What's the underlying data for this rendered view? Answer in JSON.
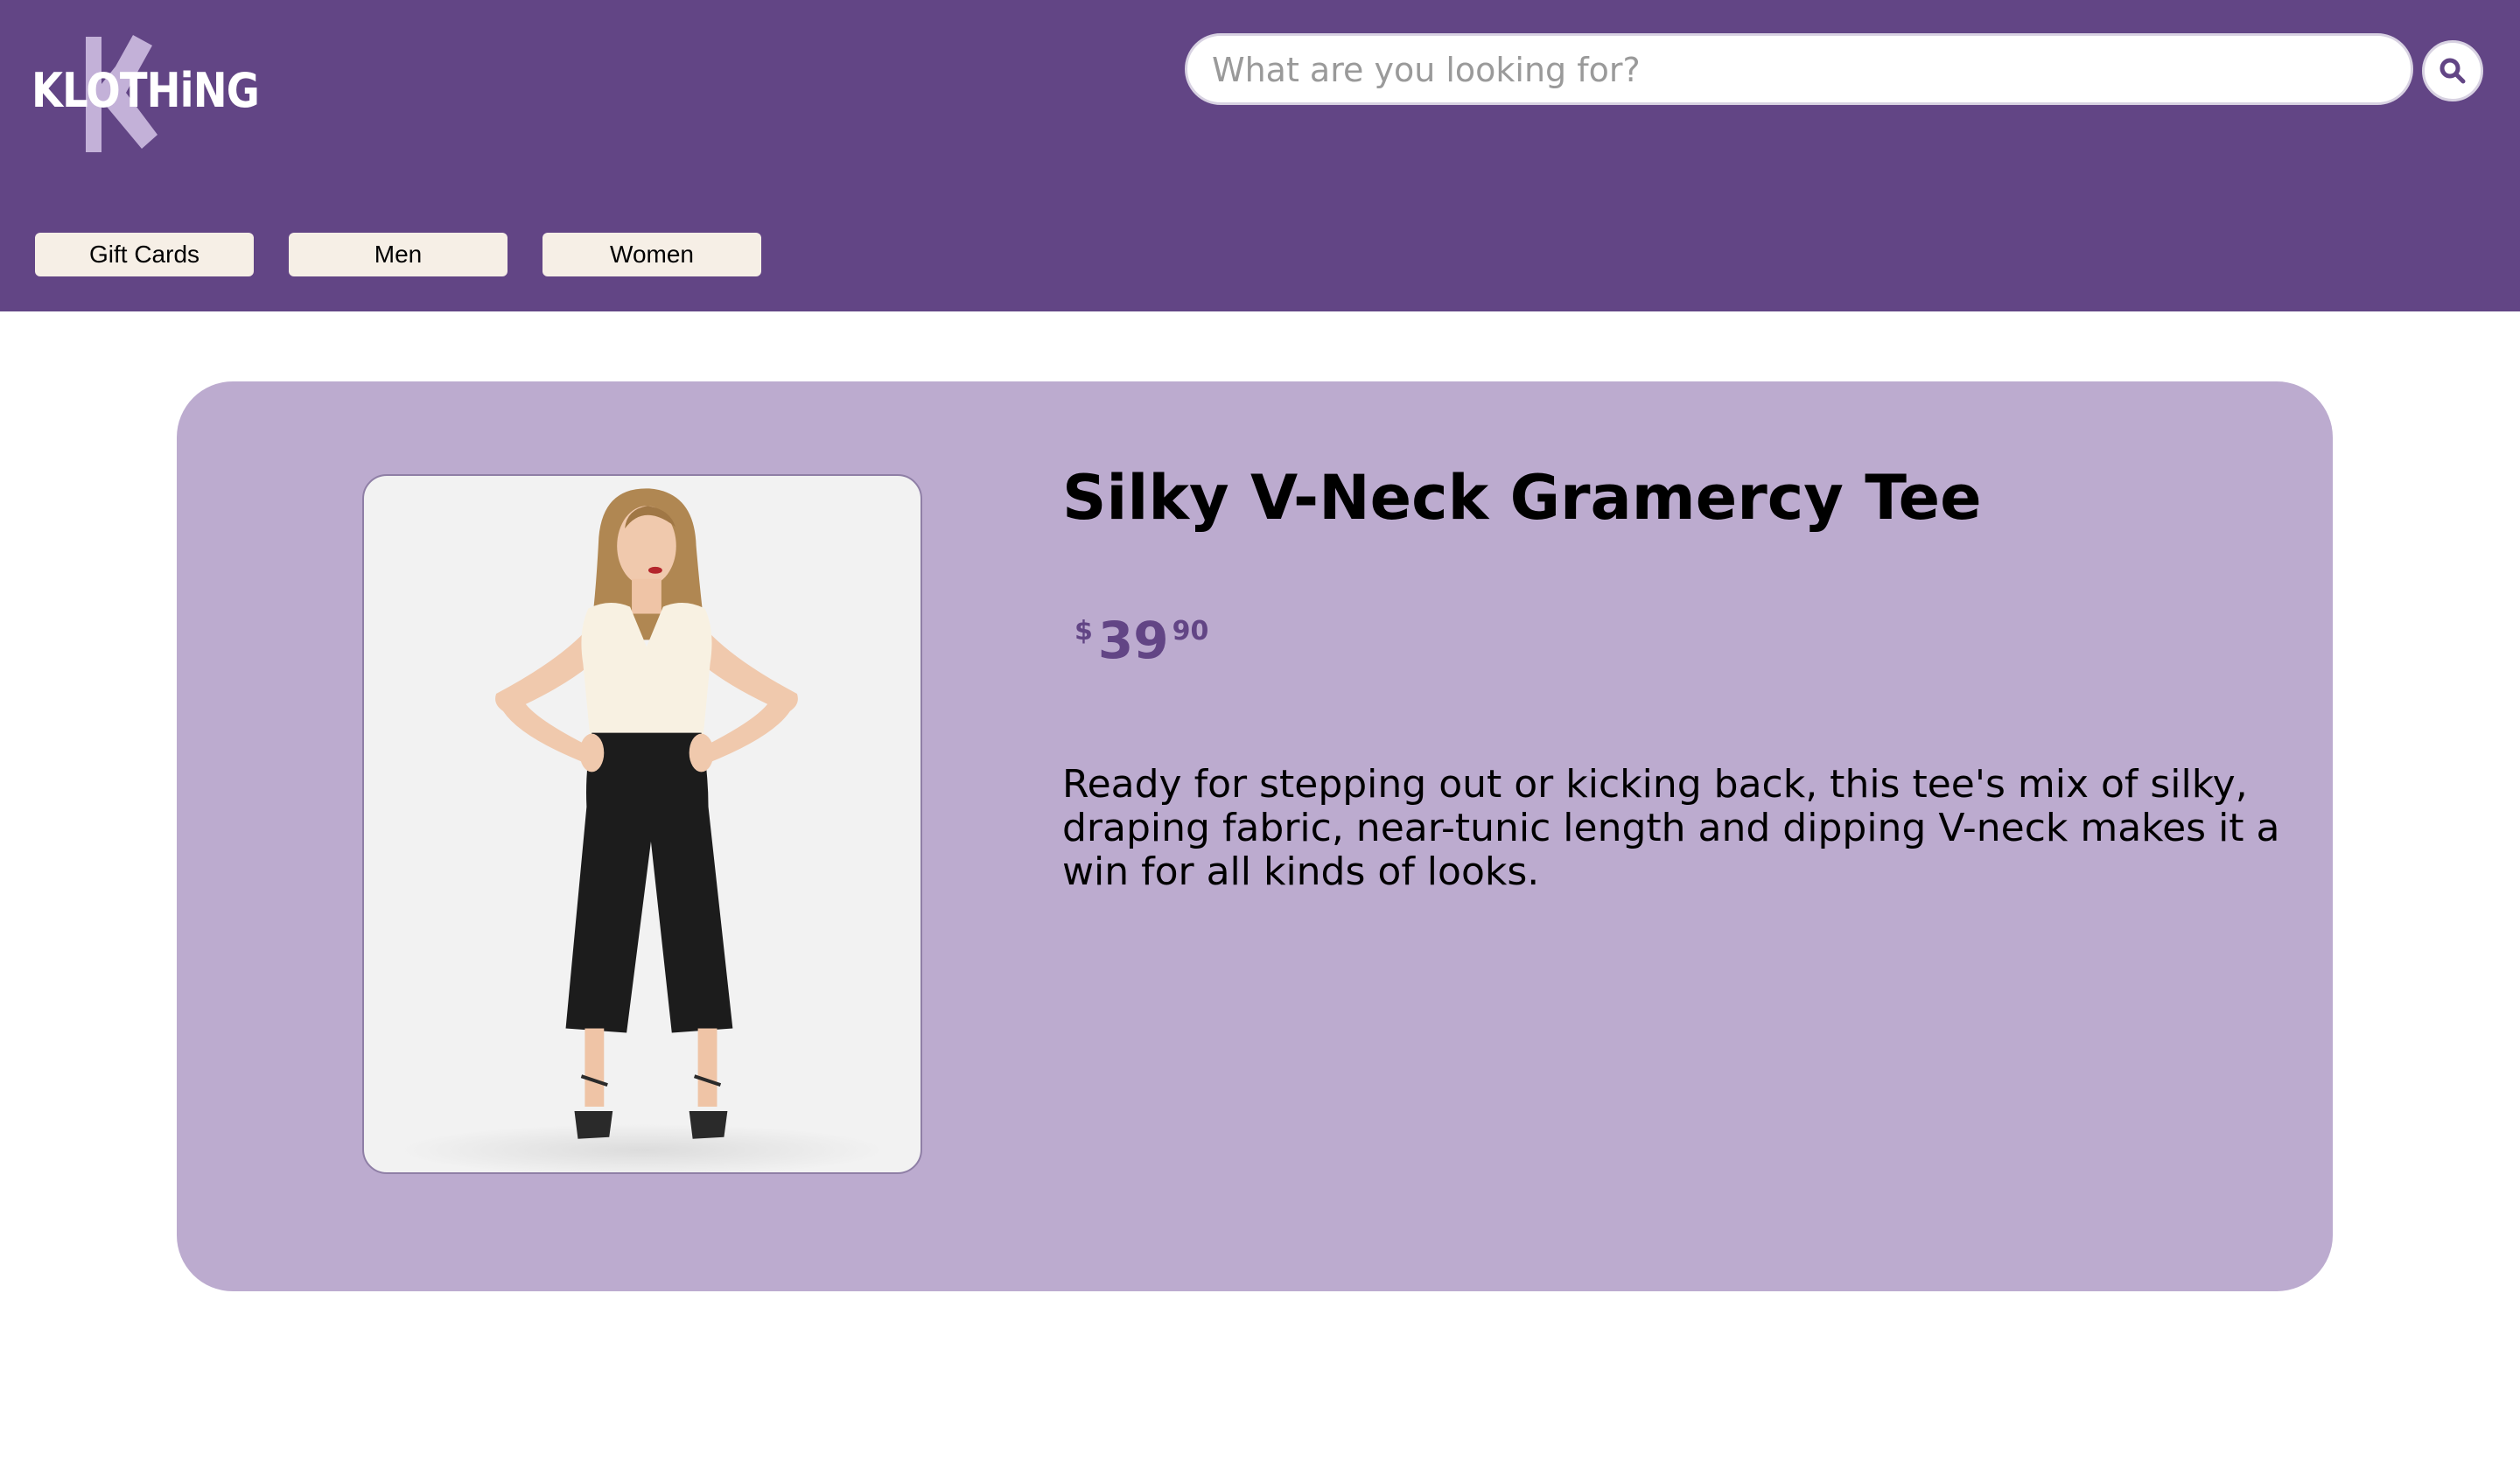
{
  "brand": {
    "logo_text": "KLOTHiNG",
    "logo_letter_color": "#c3b1d8",
    "logo_icon": "k-logo-icon"
  },
  "search": {
    "placeholder": "What are you looking for?",
    "value": "",
    "icon": "search-icon"
  },
  "nav": {
    "items": [
      {
        "label": "Gift Cards"
      },
      {
        "label": "Men"
      },
      {
        "label": "Women"
      }
    ]
  },
  "product": {
    "title": "Silky V-Neck Gramercy Tee",
    "price": {
      "currency": "$",
      "dollars": "39",
      "cents": "90"
    },
    "description": "Ready for stepping out or kicking back, this tee's mix of silky, draping fabric, near-tunic length and dipping V-neck makes it a win for all kinds of looks.",
    "image_icon": "product-photo"
  },
  "colors": {
    "header": "#624585",
    "card": "#bcabcf",
    "accent": "#624585",
    "nav_button": "#f6efe6"
  }
}
